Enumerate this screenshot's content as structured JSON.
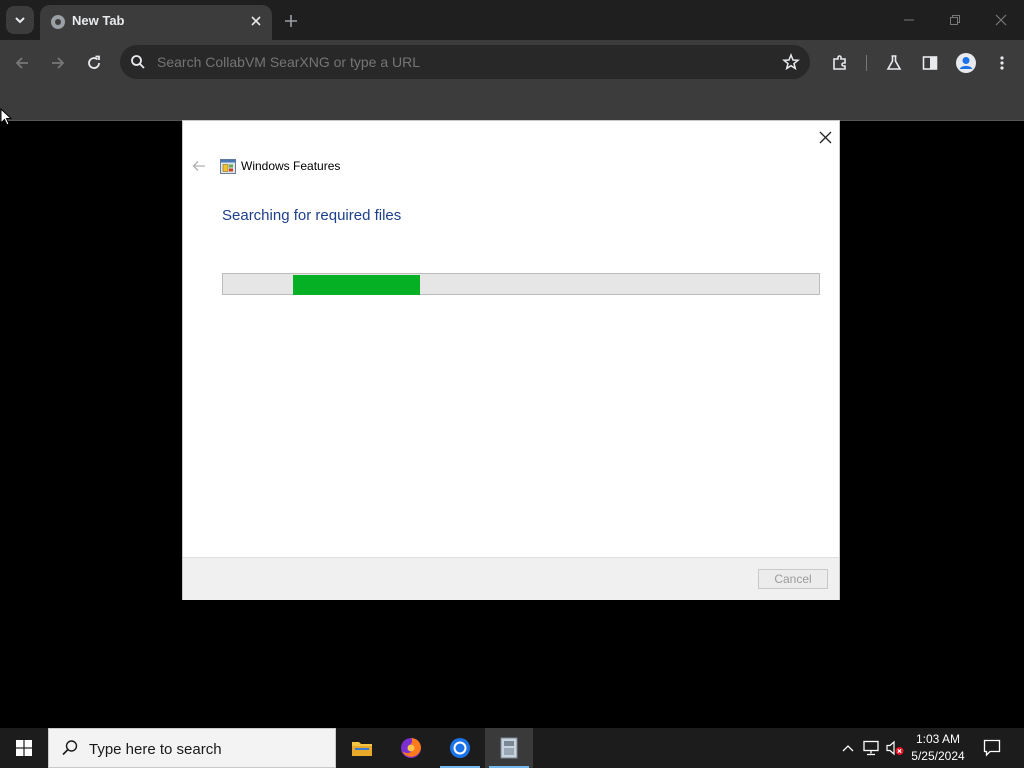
{
  "browser": {
    "tab_title": "New Tab",
    "omnibox_placeholder": "Search CollabVM SearXNG or type a URL"
  },
  "dialog": {
    "app_title": "Windows Features",
    "heading": "Searching for required files",
    "progress_fraction": 0.33,
    "cancel_label": "Cancel",
    "cancel_enabled": false
  },
  "taskbar": {
    "search_placeholder": "Type here to search",
    "pinned_apps": [
      "file-explorer",
      "firefox",
      "chrome",
      "windows-features"
    ],
    "time": "1:03 AM",
    "date": "5/25/2024"
  },
  "colors": {
    "progress_green": "#06b025",
    "heading_blue": "#1e3f8a",
    "chrome_dark": "#3c3c3c"
  }
}
